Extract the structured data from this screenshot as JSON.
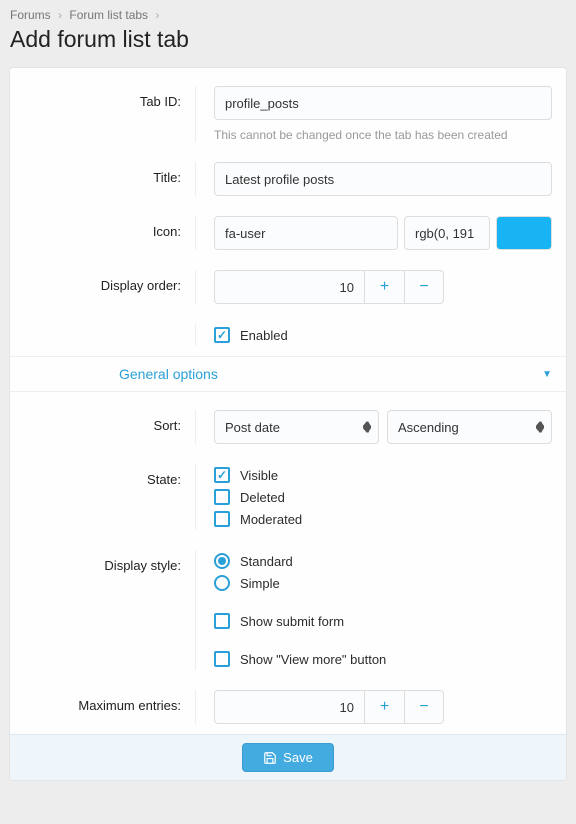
{
  "breadcrumb": {
    "item1": "Forums",
    "item2": "Forum list tabs"
  },
  "page_title": "Add forum list tab",
  "labels": {
    "tab_id": "Tab ID:",
    "title": "Title:",
    "icon": "Icon:",
    "display_order": "Display order:",
    "sort": "Sort:",
    "state": "State:",
    "display_style": "Display style:",
    "max_entries": "Maximum entries:"
  },
  "fields": {
    "tab_id": "profile_posts",
    "tab_id_help": "This cannot be changed once the tab has been created",
    "title": "Latest profile posts",
    "icon": "fa-user",
    "rgb": "rgb(0, 191",
    "display_order": "10",
    "max_entries": "10",
    "sort": "Post date",
    "direction": "Ascending"
  },
  "checks": {
    "enabled": "Enabled",
    "visible": "Visible",
    "deleted": "Deleted",
    "moderated": "Moderated",
    "show_submit": "Show submit form",
    "show_viewmore": "Show \"View more\" button"
  },
  "radios": {
    "standard": "Standard",
    "simple": "Simple"
  },
  "section": {
    "general": "General options"
  },
  "buttons": {
    "save": "Save",
    "plus": "+",
    "minus": "−"
  }
}
